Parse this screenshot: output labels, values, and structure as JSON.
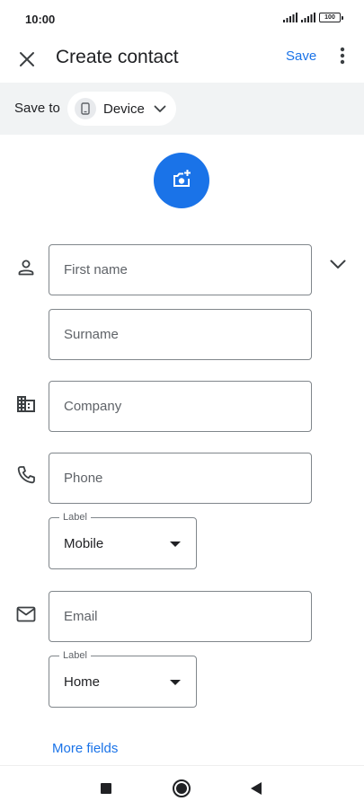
{
  "status_bar": {
    "time": "10:00",
    "battery": "100"
  },
  "app_bar": {
    "title": "Create contact",
    "save_label": "Save",
    "close_icon": "close-icon",
    "more_icon": "more-vert-icon"
  },
  "save_to": {
    "label": "Save to",
    "account": "Device",
    "account_icon": "phone-device-icon"
  },
  "form": {
    "first_name_placeholder": "First name",
    "surname_placeholder": "Surname",
    "company_placeholder": "Company",
    "phone_placeholder": "Phone",
    "phone_label_caption": "Label",
    "phone_label_value": "Mobile",
    "email_placeholder": "Email",
    "email_label_caption": "Label",
    "email_label_value": "Home"
  },
  "more_fields_label": "More fields",
  "colors": {
    "accent": "#1a73e8",
    "chip_bar_bg": "#f1f3f4",
    "border": "#80868b",
    "placeholder": "#5f6368"
  }
}
